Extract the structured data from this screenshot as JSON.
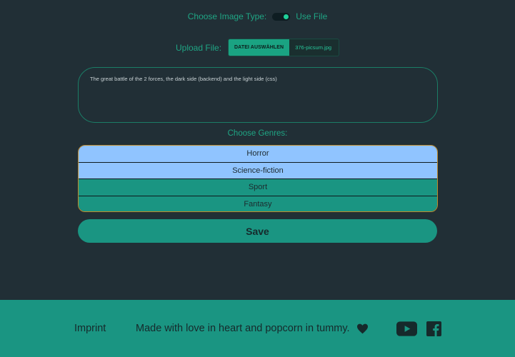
{
  "image_type": {
    "label": "Choose Image Type:",
    "toggle_state": "on",
    "option_label": "Use File"
  },
  "upload": {
    "label": "Upload File:",
    "button_label": "DATEI AUSWÄHLEN",
    "file_name": "376-picsum.jpg"
  },
  "description": {
    "value": "The great battle of the 2 forces, the dark side (backend) and the light side (css)"
  },
  "genres": {
    "label": "Choose Genres:",
    "items": [
      {
        "label": "Horror",
        "selected": true
      },
      {
        "label": "Science-fiction",
        "selected": true
      },
      {
        "label": "Sport",
        "selected": false
      },
      {
        "label": "Fantasy",
        "selected": false
      }
    ]
  },
  "save_label": "Save",
  "footer": {
    "imprint": "Imprint",
    "tagline": "Made with love in heart and popcorn in tummy.",
    "icons": [
      "heart-icon",
      "youtube-icon",
      "facebook-icon"
    ]
  },
  "colors": {
    "background": "#212f36",
    "accent": "#1a9582",
    "label_green": "#1fa584",
    "selected_genre": "#90c4ff",
    "genre_border": "#c08a2a"
  }
}
